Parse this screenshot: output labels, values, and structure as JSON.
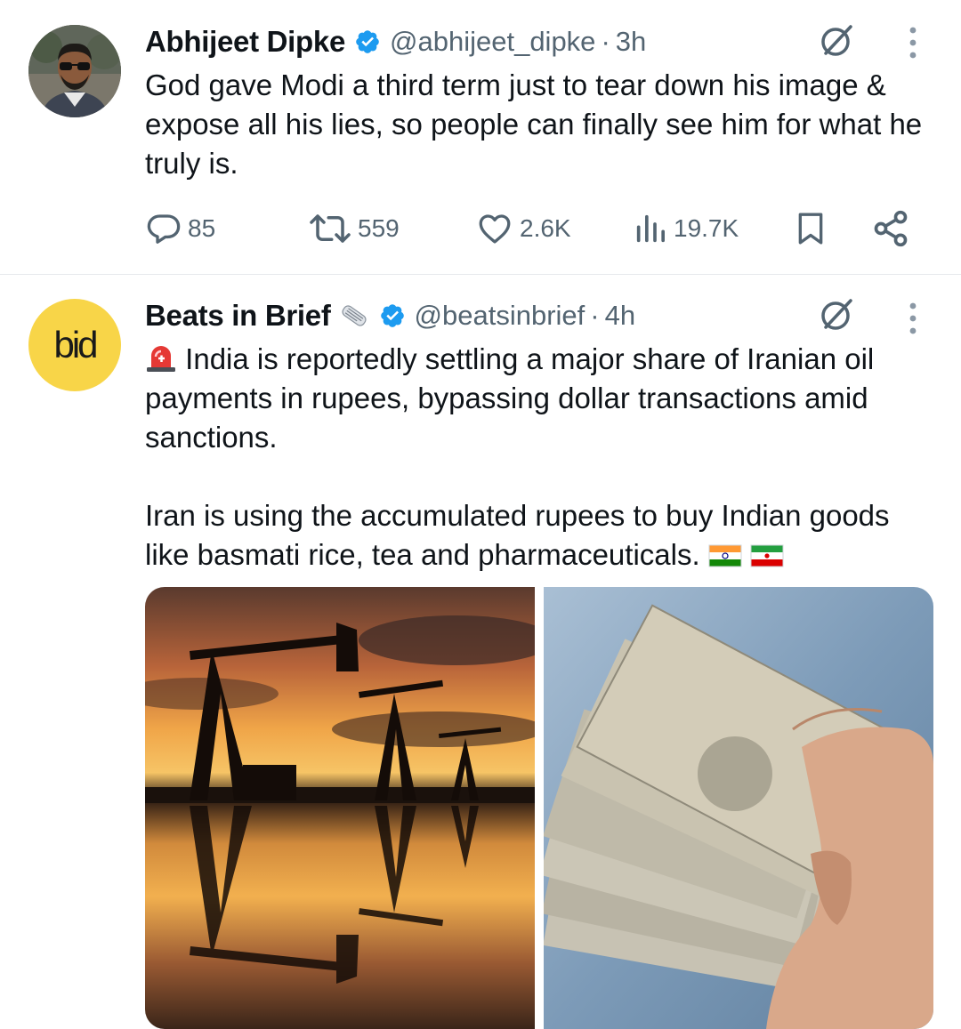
{
  "colors": {
    "text_primary": "#0f1419",
    "text_secondary": "#536471",
    "verified_blue": "#1d9bf0",
    "divider": "#e6e9ec",
    "bid_yellow": "#f8d548"
  },
  "tweets": [
    {
      "author_name": "Abhijeet Dipke",
      "handle": "@abhijeet_dipke",
      "separator": "·",
      "time": "3h",
      "text": "God gave Modi a third term just to tear down his image & expose all his lies, so people can finally see him for what he truly is.",
      "actions": {
        "replies": "85",
        "reposts": "559",
        "likes": "2.6K",
        "views": "19.7K"
      },
      "icons": [
        "verified-badge-icon",
        "grok-icon",
        "more-icon",
        "reply-icon",
        "repost-icon",
        "like-icon",
        "views-icon",
        "bookmark-icon",
        "share-icon"
      ]
    },
    {
      "author_name": "Beats in Brief",
      "avatar_text": "bid",
      "handle": "@beatsinbrief",
      "separator": "·",
      "time": "4h",
      "text_para1": "India is reportedly settling a major share of Iranian oil payments in rupees, bypassing dollar transactions amid sanctions.",
      "text_para2": "Iran is using the accumulated rupees to buy Indian goods like basmati rice, tea and pharmaceuticals.",
      "icons": [
        "newspaper-emoji-icon",
        "verified-badge-icon",
        "grok-icon",
        "more-icon",
        "siren-emoji-icon",
        "india-flag-icon",
        "iran-flag-icon"
      ],
      "media": [
        {
          "name": "oil-pumpjacks-sunset-image"
        },
        {
          "name": "rupee-notes-hand-image"
        }
      ]
    }
  ]
}
